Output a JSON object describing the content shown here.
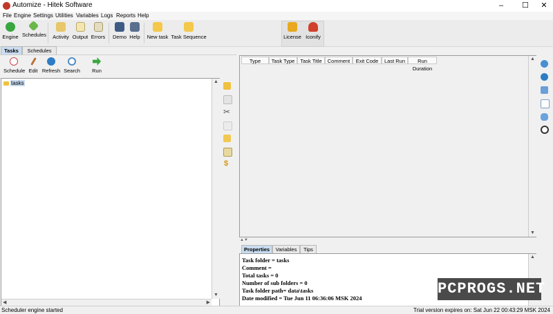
{
  "window": {
    "title": "Automize  -  Hitek Software",
    "controls": [
      "–",
      "☐",
      "✕"
    ]
  },
  "menu": [
    "File",
    "Engine",
    "Settings",
    "Utilities",
    "Variables",
    "Logs",
    "Reports",
    "Help"
  ],
  "toolbar": {
    "engine": "Engine",
    "schedules": "Schedules",
    "activity": "Activity",
    "output": "Output",
    "errors": "Errors",
    "demo": "Demo",
    "help": "Help",
    "new_task": "New task",
    "task_sequence": "Task Sequence",
    "license": "License",
    "iconify": "Iconify"
  },
  "tabs": [
    "Tasks",
    "Schedules"
  ],
  "left_toolbar": {
    "schedule": "Schedule",
    "edit": "Edit",
    "refresh": "Refresh",
    "search": "Search",
    "run": "Run"
  },
  "tree": {
    "root": "tasks"
  },
  "table": {
    "columns": [
      "Type",
      "Task Type",
      "Task Title",
      "Comment",
      "Exit Code",
      "Last Run",
      "Run Duration"
    ]
  },
  "properties": {
    "tabs": [
      "Properties",
      "Variables",
      "Tips"
    ],
    "lines": [
      "Task folder = tasks",
      "Comment =",
      "Total tasks = 0",
      "Number of sub folders = 0",
      "Task folder path= data\\tasks",
      "Date modified = Tue Jun 11 06:36:06 MSK 2024"
    ]
  },
  "status": {
    "left": "Scheduler engine started",
    "right": "Trial version expires on: Sat Jun 22 00:43:29 MSK 2024"
  },
  "watermark": "PCPROGS.NET",
  "colors": {
    "selection": "#c9dcf0",
    "window_bg": "#f0f0f0"
  }
}
